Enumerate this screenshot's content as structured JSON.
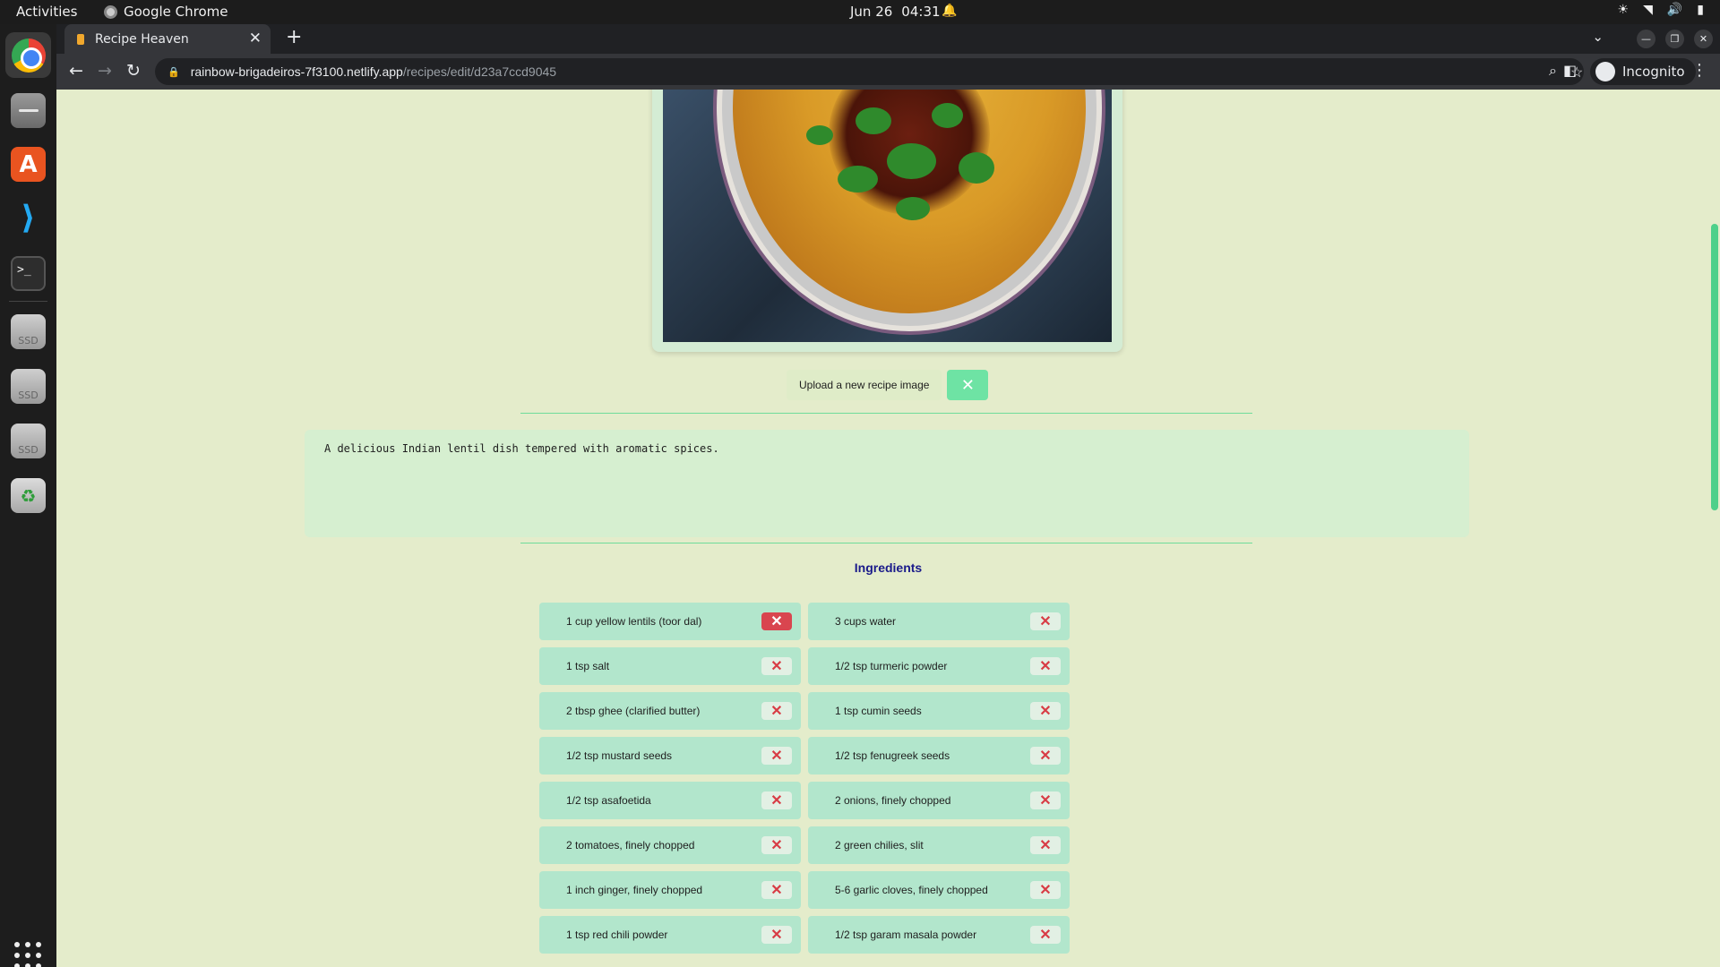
{
  "system": {
    "activities": "Activities",
    "app_name": "Google Chrome",
    "date": "Jun 26",
    "time": "04:31"
  },
  "browser": {
    "tab_title": "Recipe Heaven",
    "url_host": "rainbow-brigadeiros-7f3100.netlify.app",
    "url_path": "/recipes/edit/d23a7ccd9045",
    "profile_label": "Incognito"
  },
  "dock": {
    "ssd_label": "SSD"
  },
  "page": {
    "upload_label": "Upload a new recipe image",
    "description": "A delicious Indian lentil dish tempered with aromatic spices.",
    "ingredients_title": "Ingredients",
    "ingredients": [
      "1 cup yellow lentils (toor dal)",
      "3 cups water",
      "1 tsp salt",
      "1/2 tsp turmeric powder",
      "2 tbsp ghee (clarified butter)",
      "1 tsp cumin seeds",
      "1/2 tsp mustard seeds",
      "1/2 tsp fenugreek seeds",
      "1/2 tsp asafoetida",
      "2 onions, finely chopped",
      "2 tomatoes, finely chopped",
      "2 green chilies, slit",
      "1 inch ginger, finely chopped",
      "5-6 garlic cloves, finely chopped",
      "1 tsp red chili powder",
      "1/2 tsp garam masala powder"
    ]
  },
  "colors": {
    "page_bg": "#e4eccb",
    "ingredient_bg": "#b2e6cc",
    "remove_red": "#d9454f",
    "accent_green": "#6ee3a4",
    "title_navy": "#1a1a8a"
  }
}
